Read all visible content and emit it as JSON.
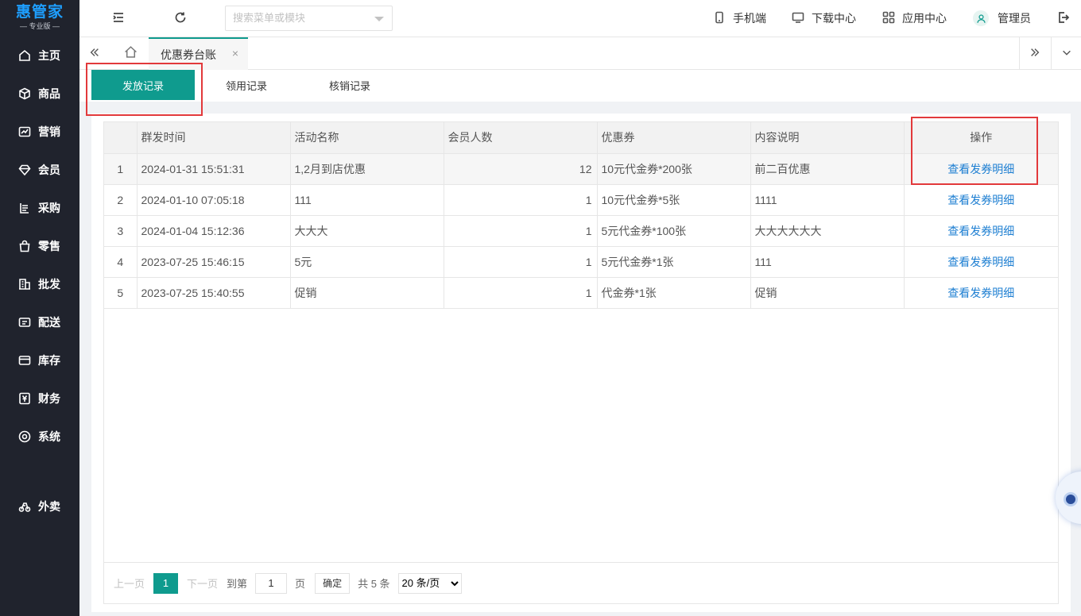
{
  "brand": {
    "name": "惠管家",
    "edition": "— 专业版 —",
    "color": "#1e9fff"
  },
  "sidebar": {
    "items": [
      {
        "label": "主页",
        "icon": "home-icon"
      },
      {
        "label": "商品",
        "icon": "cube-icon"
      },
      {
        "label": "营销",
        "icon": "chart-icon"
      },
      {
        "label": "会员",
        "icon": "diamond-icon"
      },
      {
        "label": "采购",
        "icon": "list-icon"
      },
      {
        "label": "零售",
        "icon": "bag-icon"
      },
      {
        "label": "批发",
        "icon": "building-icon"
      },
      {
        "label": "配送",
        "icon": "delivery-icon"
      },
      {
        "label": "库存",
        "icon": "box-icon"
      },
      {
        "label": "财务",
        "icon": "yen-icon"
      },
      {
        "label": "系统",
        "icon": "settings-icon"
      },
      {
        "label": "外卖",
        "icon": "scooter-icon"
      }
    ]
  },
  "header": {
    "search_placeholder": "搜索菜单或模块",
    "links": {
      "mobile": "手机端",
      "download": "下载中心",
      "apps": "应用中心",
      "user": "管理员"
    }
  },
  "tabs": {
    "current": "优惠券台账",
    "close": "×"
  },
  "subtabs": [
    "发放记录",
    "领用记录",
    "核销记录"
  ],
  "table": {
    "headers": [
      "",
      "群发时间",
      "活动名称",
      "会员人数",
      "优惠券",
      "内容说明",
      "操作"
    ],
    "rows": [
      {
        "no": "1",
        "time": "2024-01-31 15:51:31",
        "name": "1,2月到店优惠",
        "count": "12",
        "coupon": "10元代金券*200张",
        "desc": "前二百优惠",
        "action": "查看发券明细"
      },
      {
        "no": "2",
        "time": "2024-01-10 07:05:18",
        "name": "111",
        "count": "1",
        "coupon": "10元代金券*5张",
        "desc": "1111",
        "action": "查看发券明细"
      },
      {
        "no": "3",
        "time": "2024-01-04 15:12:36",
        "name": "大大大",
        "count": "1",
        "coupon": "5元代金券*100张",
        "desc": "大大大大大大",
        "action": "查看发券明细"
      },
      {
        "no": "4",
        "time": "2023-07-25 15:46:15",
        "name": "5元",
        "count": "1",
        "coupon": "5元代金券*1张",
        "desc": "111",
        "action": "查看发券明细"
      },
      {
        "no": "5",
        "time": "2023-07-25 15:40:55",
        "name": "促销",
        "count": "1",
        "coupon": "代金券*1张",
        "desc": "促销",
        "action": "查看发券明细"
      }
    ]
  },
  "pager": {
    "prev": "上一页",
    "current": "1",
    "next": "下一页",
    "goto": "到第",
    "goto_value": "1",
    "page_unit": "页",
    "confirm": "确定",
    "total": "共 5 条",
    "page_size": "20 条/页"
  },
  "colors": {
    "accent": "#0f9b8e",
    "sidebar": "#20232d",
    "link": "#1e7fd2",
    "highlight": "#e2393b"
  }
}
